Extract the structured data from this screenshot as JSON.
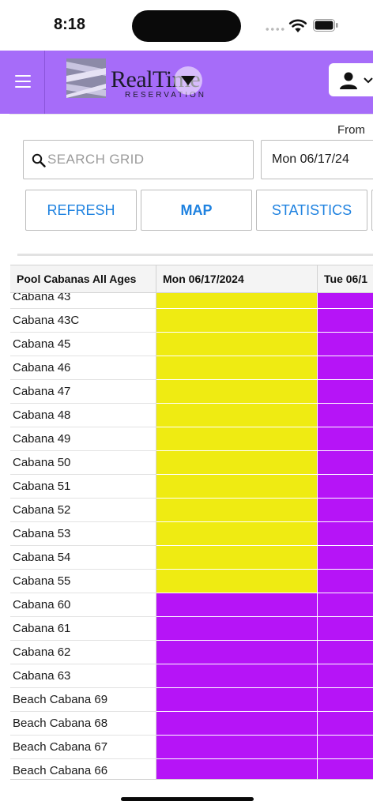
{
  "status_bar": {
    "time": "8:18"
  },
  "header": {
    "brand_name": "RealTime",
    "brand_sub": "RESERVATION",
    "brand_color": "#a66cf9"
  },
  "filters": {
    "from_label": "From",
    "search_placeholder": "SEARCH GRID",
    "date_value": "Mon 06/17/24",
    "buttons": {
      "refresh": "REFRESH",
      "map": "MAP",
      "statistics": "STATISTICS"
    }
  },
  "grid": {
    "headers": [
      "Pool Cabanas All Ages",
      "Mon 06/17/2024",
      "Tue 06/1"
    ],
    "legend_colors": {
      "yellow": "#efeb12",
      "purple": "#b614f7"
    },
    "rows": [
      {
        "name": "Cabana 43",
        "day1": "yellow",
        "day2": "purple"
      },
      {
        "name": "Cabana 43C",
        "day1": "yellow",
        "day2": "purple"
      },
      {
        "name": "Cabana 45",
        "day1": "yellow",
        "day2": "purple"
      },
      {
        "name": "Cabana 46",
        "day1": "yellow",
        "day2": "purple"
      },
      {
        "name": "Cabana 47",
        "day1": "yellow",
        "day2": "purple"
      },
      {
        "name": "Cabana 48",
        "day1": "yellow",
        "day2": "purple"
      },
      {
        "name": "Cabana 49",
        "day1": "yellow",
        "day2": "purple"
      },
      {
        "name": "Cabana 50",
        "day1": "yellow",
        "day2": "purple"
      },
      {
        "name": "Cabana 51",
        "day1": "yellow",
        "day2": "purple"
      },
      {
        "name": "Cabana 52",
        "day1": "yellow",
        "day2": "purple"
      },
      {
        "name": "Cabana 53",
        "day1": "yellow",
        "day2": "purple"
      },
      {
        "name": "Cabana 54",
        "day1": "yellow",
        "day2": "purple"
      },
      {
        "name": "Cabana 55",
        "day1": "yellow",
        "day2": "purple"
      },
      {
        "name": "Cabana 60",
        "day1": "purple",
        "day2": "purple"
      },
      {
        "name": "Cabana 61",
        "day1": "purple",
        "day2": "purple"
      },
      {
        "name": "Cabana 62",
        "day1": "purple",
        "day2": "purple"
      },
      {
        "name": "Cabana 63",
        "day1": "purple",
        "day2": "purple"
      },
      {
        "name": "Beach Cabana 69",
        "day1": "purple",
        "day2": "purple"
      },
      {
        "name": "Beach Cabana 68",
        "day1": "purple",
        "day2": "purple"
      },
      {
        "name": "Beach Cabana 67",
        "day1": "purple",
        "day2": "purple"
      },
      {
        "name": "Beach Cabana 66",
        "day1": "purple",
        "day2": "purple"
      }
    ]
  }
}
